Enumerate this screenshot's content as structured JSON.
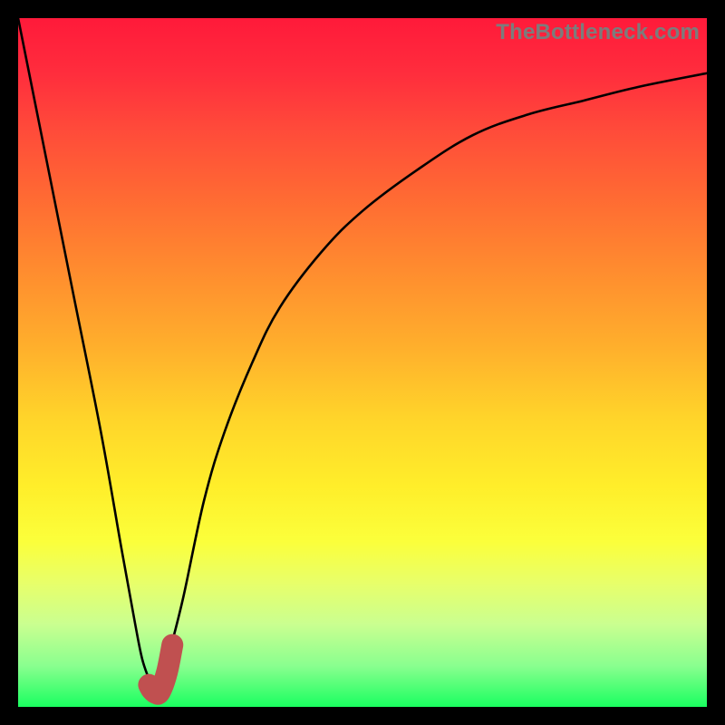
{
  "watermark": {
    "text": "TheBottleneck.com"
  },
  "colors": {
    "curve_thin": "#000000",
    "curve_thick": "#c05050",
    "background_black": "#000000"
  },
  "chart_data": {
    "type": "line",
    "title": "",
    "xlabel": "",
    "ylabel": "",
    "xlim": [
      0,
      100
    ],
    "ylim": [
      0,
      100
    ],
    "grid": false,
    "legend": false,
    "series": [
      {
        "name": "bottleneck-curve",
        "x": [
          0,
          4,
          8,
          12,
          15,
          17,
          18,
          19,
          19.5,
          20,
          21,
          22,
          24,
          27,
          30,
          34,
          38,
          44,
          50,
          58,
          66,
          74,
          82,
          90,
          100
        ],
        "values": [
          100,
          80,
          60,
          40,
          23,
          12,
          7,
          4,
          2.5,
          2,
          4,
          8,
          16,
          30,
          40,
          50,
          58,
          66,
          72,
          78,
          83,
          86,
          88,
          90,
          92
        ]
      },
      {
        "name": "highlight-minimum",
        "x": [
          19.0,
          19.4,
          20.0,
          20.6,
          21.6,
          22.4
        ],
        "values": [
          3.2,
          2.5,
          2.0,
          2.2,
          5.0,
          9.0
        ]
      }
    ],
    "notes": "Background is a vertical red→green gradient indicating bottleneck severity; the black line is the bottleneck percentage curve with a sharp minimum near x≈20; the thick desaturated-red J-shaped segment highlights the region around the minimum."
  }
}
